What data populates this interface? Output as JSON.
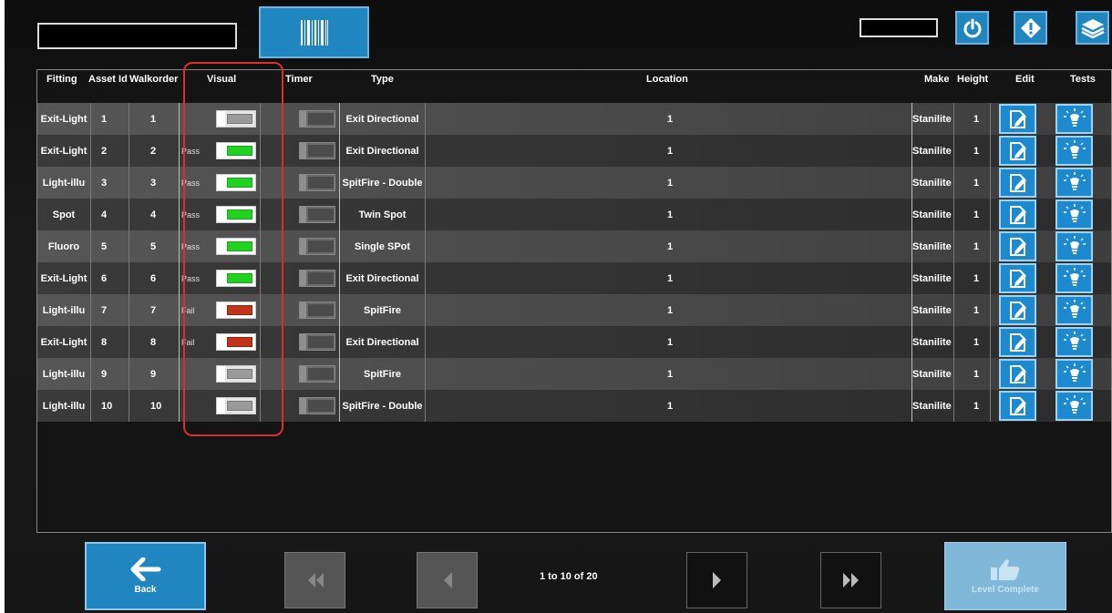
{
  "topbar": {
    "search_value": "",
    "right_field_value": "",
    "barcode_icon": "barcode-icon",
    "power_icon": "power-icon",
    "alert_icon": "alert-diamond-icon",
    "layers_icon": "layers-icon"
  },
  "grid": {
    "headers": {
      "fitting": "Fitting",
      "asset_id": "Asset Id",
      "walkorder": "Walkorder",
      "visual": "Visual",
      "timer": "Timer",
      "type": "Type",
      "location": "Location",
      "make": "Make",
      "height": "Height",
      "edit": "Edit",
      "tests": "Tests"
    },
    "rows": [
      {
        "fitting": "Exit-Light",
        "asset_id": "1",
        "walkorder": "1",
        "visual_label": "",
        "visual_state": "off",
        "type": "Exit Directional",
        "location": "1",
        "make": "Stanilite",
        "height": "1"
      },
      {
        "fitting": "Exit-Light",
        "asset_id": "2",
        "walkorder": "2",
        "visual_label": "Pass",
        "visual_state": "pass",
        "type": "Exit Directional",
        "location": "1",
        "make": "Stanilite",
        "height": "1"
      },
      {
        "fitting": "Light-illu",
        "asset_id": "3",
        "walkorder": "3",
        "visual_label": "Pass",
        "visual_state": "pass",
        "type": "SpitFire - Double",
        "location": "1",
        "make": "Stanilite",
        "height": "1"
      },
      {
        "fitting": "Spot",
        "asset_id": "4",
        "walkorder": "4",
        "visual_label": "Pass",
        "visual_state": "pass",
        "type": "Twin Spot",
        "location": "1",
        "make": "Stanilite",
        "height": "1"
      },
      {
        "fitting": "Fluoro",
        "asset_id": "5",
        "walkorder": "5",
        "visual_label": "Pass",
        "visual_state": "pass",
        "type": "Single SPot",
        "location": "1",
        "make": "Stanilite",
        "height": "1"
      },
      {
        "fitting": "Exit-Light",
        "asset_id": "6",
        "walkorder": "6",
        "visual_label": "Pass",
        "visual_state": "pass",
        "type": "Exit Directional",
        "location": "1",
        "make": "Stanilite",
        "height": "1"
      },
      {
        "fitting": "Light-illu",
        "asset_id": "7",
        "walkorder": "7",
        "visual_label": "Fail",
        "visual_state": "fail",
        "type": "SpitFire",
        "location": "1",
        "make": "Stanilite",
        "height": "1"
      },
      {
        "fitting": "Exit-Light",
        "asset_id": "8",
        "walkorder": "8",
        "visual_label": "Fail",
        "visual_state": "fail",
        "type": "Exit Directional",
        "location": "1",
        "make": "Stanilite",
        "height": "1"
      },
      {
        "fitting": "Light-illu",
        "asset_id": "9",
        "walkorder": "9",
        "visual_label": "",
        "visual_state": "off",
        "type": "SpitFire",
        "location": "1",
        "make": "Stanilite",
        "height": "1"
      },
      {
        "fitting": "Light-illu",
        "asset_id": "10",
        "walkorder": "10",
        "visual_label": "",
        "visual_state": "off",
        "type": "SpitFire - Double",
        "location": "1",
        "make": "Stanilite",
        "height": "1"
      }
    ],
    "edit_icon": "edit-document-icon",
    "tests_icon": "light-bulb-icon",
    "pass_color": "#21d321",
    "fail_color": "#c1341a",
    "accent_color": "#1f86c0"
  },
  "footer": {
    "back_label": "Back",
    "pager_text": "1 to 10 of 20",
    "level_complete_label": "Level Complete"
  }
}
